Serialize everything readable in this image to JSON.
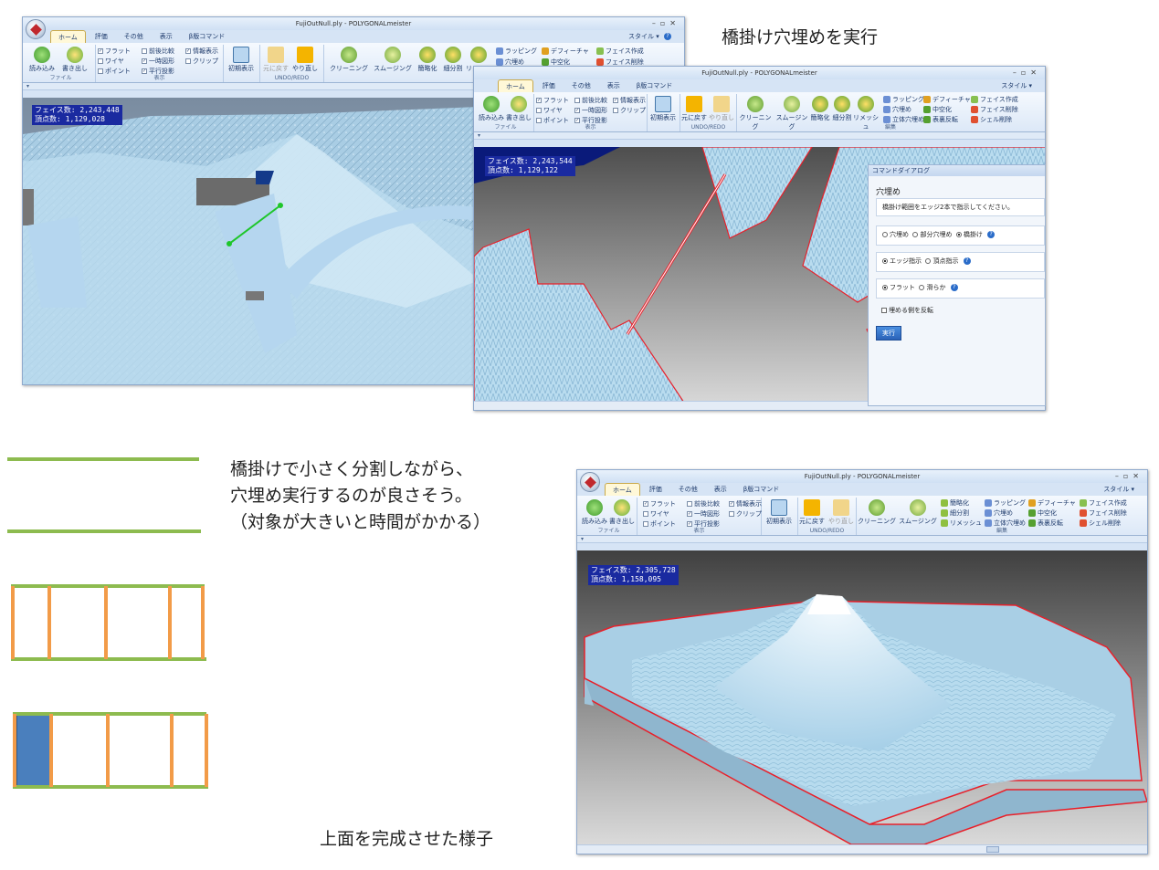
{
  "captions": {
    "top_right": "橋掛け穴埋めを実行",
    "bottom": "上面を完成させた様子",
    "note": "橋掛けで小さく分割しながら、\n穴埋め実行するのが良さそう。\n（対象が大きいと時間がかかる）"
  },
  "app": {
    "title": "FujiOutNull.ply - POLYGONALmeister",
    "tabs": [
      "ホーム",
      "評価",
      "その他",
      "表示",
      "β版コマンド"
    ],
    "style_label": "スタイル",
    "groups": {
      "file": "ファイル",
      "view": "表示",
      "undo": "UNDO/REDO",
      "edit": "編集"
    },
    "buttons": {
      "load": "読み込み",
      "save": "書き出し",
      "init_view": "初期表示",
      "undo": "元に戻す",
      "redo": "やり直し",
      "cleaning": "クリーニング",
      "smoothing": "スムージング",
      "simplify": "簡略化",
      "subdivide": "細分割",
      "remesh": "リメッシュ",
      "wrapping": "ラッピング",
      "defeature": "デフィーチャ",
      "face_create": "フェイス作成",
      "fill_hole": "穴埋め",
      "hollow": "中空化",
      "face_delete": "フェイス削除",
      "solid_fill": "立体穴埋め",
      "flip": "表裏反転",
      "shell_delete": "シェル削除"
    },
    "checks": {
      "flat": "フラット",
      "wire": "ワイヤ",
      "point": "ポイント",
      "compare": "前後比較",
      "temp_shape": "一時図形",
      "parallel": "平行投影",
      "info": "情報表示",
      "clip": "クリップ"
    }
  },
  "window1": {
    "faces": "フェイス数: 2,243,448",
    "verts": "頂点数: 1,129,028"
  },
  "window2": {
    "faces": "フェイス数: 2,243,544",
    "verts": "頂点数: 1,129,122"
  },
  "window3": {
    "faces": "フェイス数: 2,305,728",
    "verts": "頂点数: 1,158,095"
  },
  "dialog": {
    "title": "コマンドダイアログ",
    "heading": "穴埋め",
    "hint": "橋掛け範囲をエッジ2本で指示してください。",
    "mode_options": [
      "穴埋め",
      "部分穴埋め",
      "橋掛け"
    ],
    "mode_selected": "橋掛け",
    "spec_options": [
      "エッジ指示",
      "頂点指示"
    ],
    "spec_selected": "エッジ指示",
    "shape_options": [
      "フラット",
      "滑らか"
    ],
    "shape_selected": "フラット",
    "reverse_label": "埋める側を反転",
    "exec_label": "実行"
  },
  "colors": {
    "mesh": "#a9d2ea",
    "boundary": "#e8202a",
    "info_bg": "#1a2aa0",
    "green_line": "#8dbb4f",
    "orange_line": "#f29b48",
    "blue_fill": "#4a7fbd"
  }
}
